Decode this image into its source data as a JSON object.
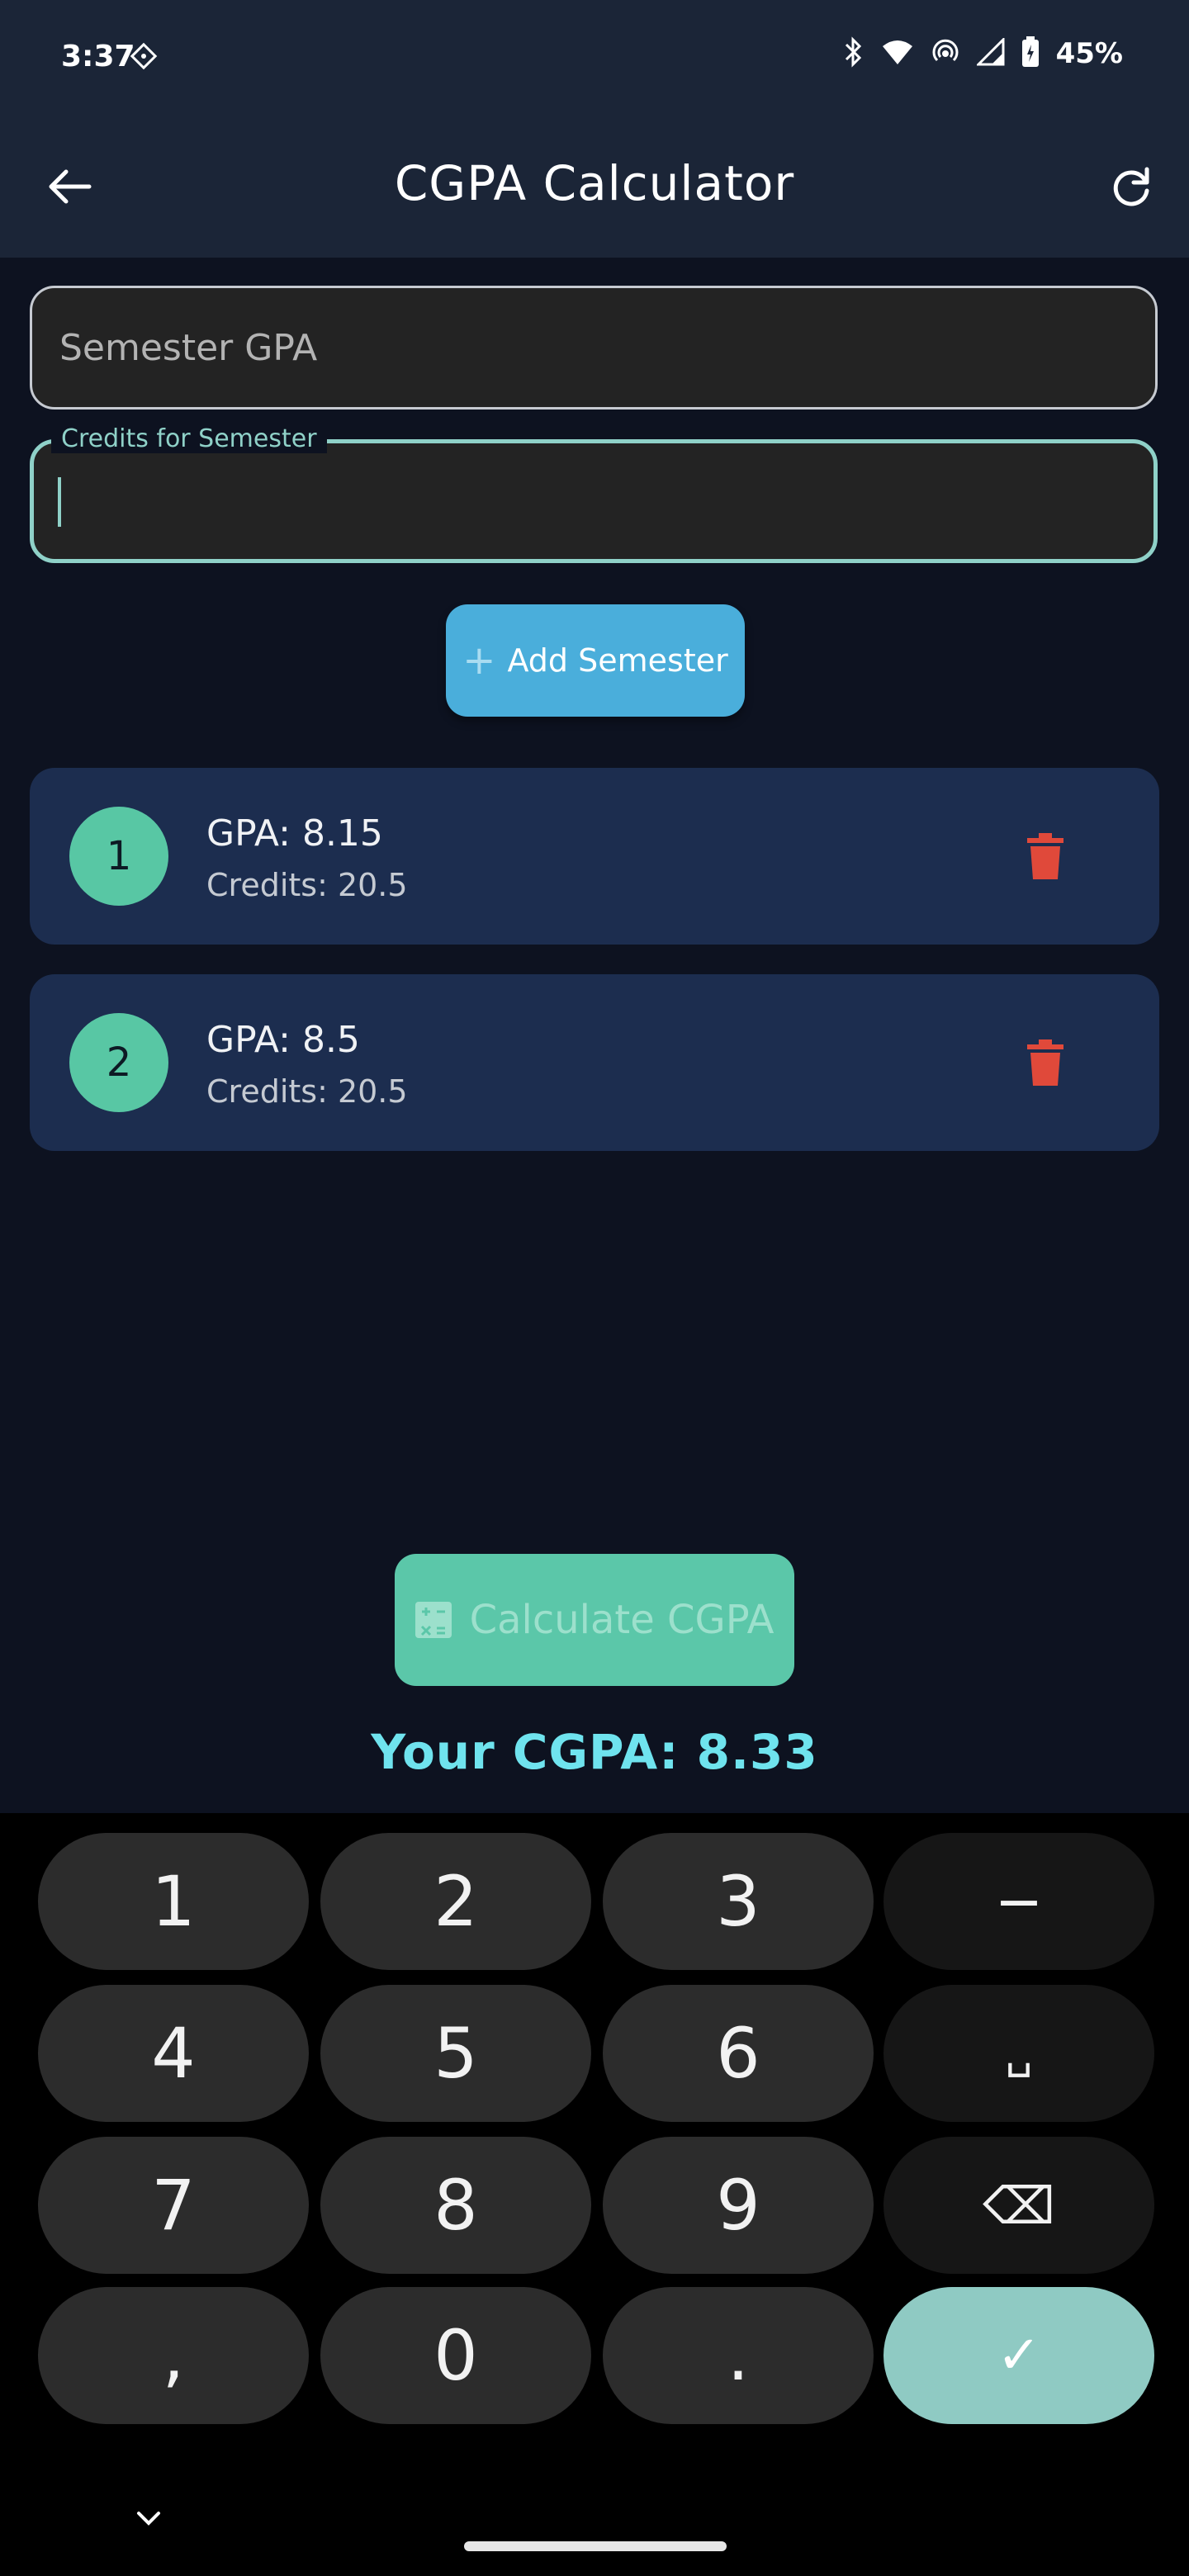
{
  "status_bar": {
    "time": "3:37",
    "battery_percent": "45%",
    "icons": [
      "diamond-icon",
      "bluetooth-icon",
      "wifi-icon",
      "hotspot-icon",
      "signal-icon",
      "battery-icon"
    ]
  },
  "app_bar": {
    "title": "CGPA Calculator",
    "back_icon": "arrow-left-icon",
    "refresh_icon": "refresh-icon"
  },
  "form": {
    "gpa_placeholder": "Semester GPA",
    "credits_label": "Credits for Semester",
    "credits_value": ""
  },
  "add_button": {
    "label": "Add Semester",
    "icon": "plus-icon"
  },
  "semesters": [
    {
      "number": "1",
      "gpa": "GPA: 8.15",
      "credits": "Credits: 20.5"
    },
    {
      "number": "2",
      "gpa": "GPA: 8.5",
      "credits": "Credits: 20.5"
    }
  ],
  "calculate_button": {
    "label": "Calculate CGPA",
    "icon": "calculator-icon"
  },
  "result": "Your CGPA: 8.33",
  "keyboard": {
    "rows": [
      [
        "1",
        "2",
        "3",
        "−"
      ],
      [
        "4",
        "5",
        "6",
        "␣"
      ],
      [
        "7",
        "8",
        "9",
        "⌫"
      ],
      [
        ",",
        "0",
        ".",
        "✓"
      ]
    ]
  },
  "colors": {
    "accent_teal": "#5bc7a9",
    "accent_blue": "#4aaedb",
    "delete_red": "#e0493a",
    "result_cyan": "#6fe3ee"
  }
}
